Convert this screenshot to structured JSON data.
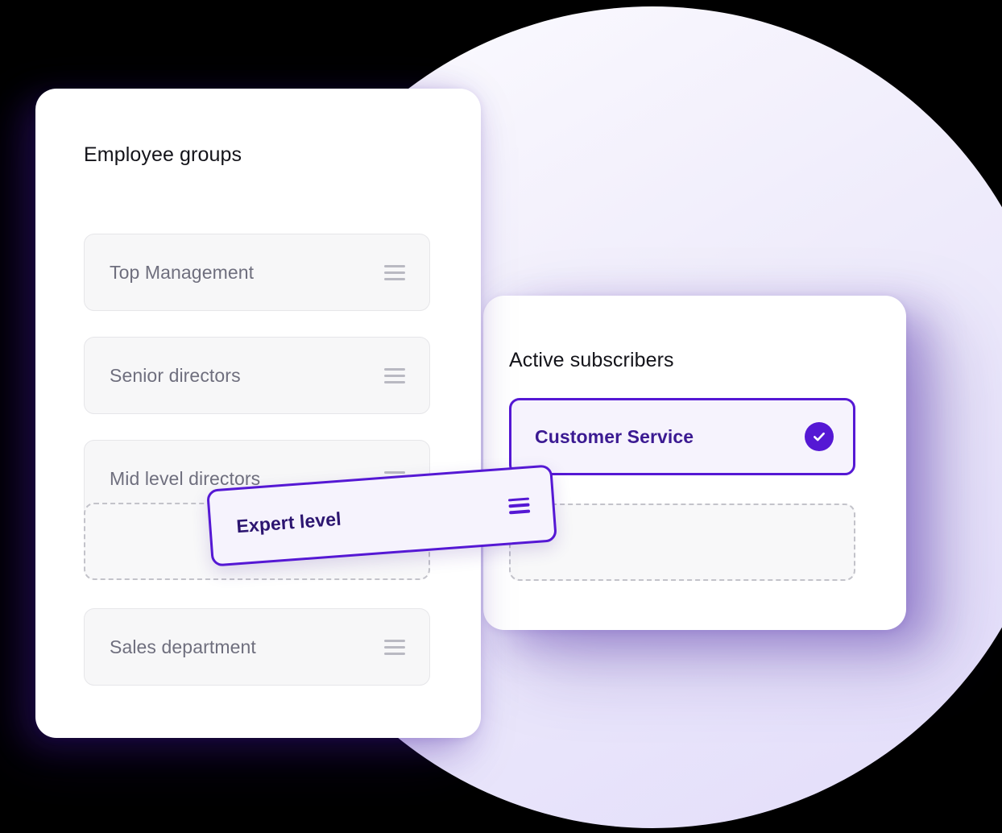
{
  "theme": {
    "accent_purple": "#5518d4",
    "accent_text_purple": "#3b1a92",
    "row_bg": "#f7f7f8",
    "row_border": "#e6e6e9",
    "row_text": "#6f6f7e",
    "title_text": "#14141a",
    "card_bg": "#ffffff",
    "selected_bg": "#f6f3fd",
    "placeholder_border": "#c3c3ca",
    "backdrop_circle_top": "#fdfdff",
    "backdrop_circle_bottom": "#e2dcfa",
    "page_bg": "#000000"
  },
  "employee_groups_panel": {
    "title": "Employee groups",
    "handle_icon": "drag-handle-icon",
    "rows": [
      {
        "label": "Top Management"
      },
      {
        "label": "Senior directors"
      },
      {
        "label": "Mid level directors"
      },
      {
        "label": "Sales department"
      }
    ],
    "placeholder": {
      "label": ""
    }
  },
  "active_subscribers_panel": {
    "title": "Active subscribers",
    "selected_row": {
      "label": "Customer Service",
      "badge_icon": "check-circle-icon",
      "selected": true
    },
    "placeholder": {
      "label": ""
    }
  },
  "dragged_card": {
    "label": "Expert level",
    "handle_icon": "drag-handle-icon",
    "rotation_deg": -4.2,
    "state": "dragging"
  }
}
